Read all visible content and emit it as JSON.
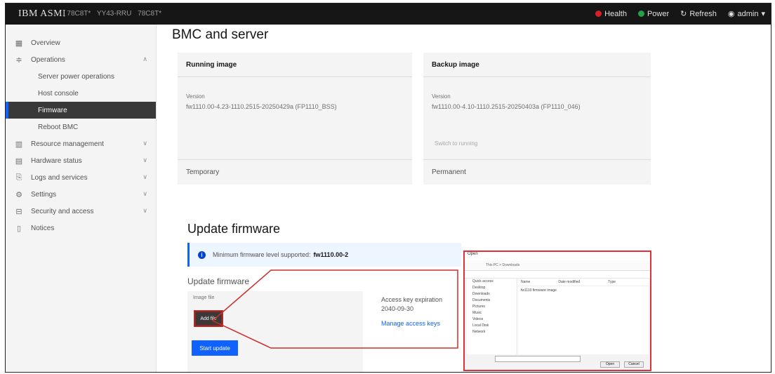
{
  "header": {
    "brand": "IBM ASMI",
    "crumbs": [
      "| 78C8T*",
      "YY43-RRU",
      "78C8T*"
    ],
    "health": "Health",
    "power": "Power",
    "refresh": "Refresh",
    "user": "admin",
    "colors": {
      "health": "#da1e28",
      "power": "#24a148"
    }
  },
  "sidebar": {
    "items": [
      {
        "label": "Overview",
        "icon": "grid-icon"
      },
      {
        "label": "Operations",
        "icon": "sliders-icon"
      },
      {
        "label": "Server power operations",
        "sub": true
      },
      {
        "label": "Host console",
        "sub": true
      },
      {
        "label": "Firmware",
        "sub": true,
        "active": true
      },
      {
        "label": "Reboot BMC",
        "sub": true
      },
      {
        "label": "Resource management",
        "icon": "chart-icon"
      },
      {
        "label": "Hardware status",
        "icon": "hardware-icon"
      },
      {
        "label": "Logs and services",
        "icon": "logs-icon"
      },
      {
        "label": "Settings",
        "icon": "gear-icon"
      },
      {
        "label": "Security and access",
        "icon": "lock-icon"
      },
      {
        "label": "Notices",
        "icon": "document-icon"
      }
    ]
  },
  "main": {
    "title": "BMC and server",
    "running": {
      "header": "Running image",
      "version_label": "Version",
      "version": "fw1110.00-4.23-1110.2515-20250429a (FP1110_BSS)",
      "footer": "Temporary"
    },
    "backup": {
      "header": "Backup image",
      "version_label": "Version",
      "version": "fw1110.00-4.10-1110.2515-20250403a (FP1110_046)",
      "switch": "Switch to running",
      "footer": "Permanent"
    },
    "update_title": "Update firmware",
    "notification": "Minimum firmware level supported:",
    "notification_value": "fw1110.00-2",
    "update_label": "Update firmware",
    "file_label": "Image file",
    "add_file": "Add file",
    "start_update": "Start update",
    "access_key_label": "Access key expiration",
    "access_key_value": "2040-09-30",
    "manage_keys": "Manage access keys"
  },
  "dialog": {
    "title": "Open",
    "address": "This PC > Downloads",
    "nav": [
      "Quick access",
      "Desktop",
      "Downloads",
      "Documents",
      "Pictures",
      "Music",
      "Videos",
      "Local Disk",
      "Network"
    ],
    "columns": [
      "Name",
      "Date modified",
      "Type"
    ],
    "file": "fw1110 firmware image",
    "buttons": [
      "Open",
      "Cancel"
    ]
  }
}
